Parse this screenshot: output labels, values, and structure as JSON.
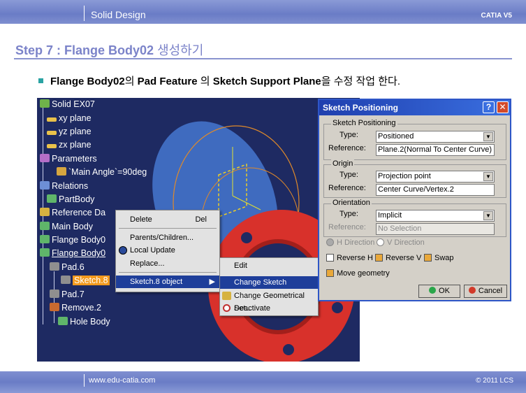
{
  "header": {
    "section_title": "Solid Design",
    "brand": "CATIA V5"
  },
  "slide": {
    "title_en": "Step 7 : Flange Body02",
    "title_ko": "생성하기",
    "bullet": {
      "p1": "Flange Body02",
      "p2": "의 ",
      "p3": "Pad Feature",
      "p4": " 의 ",
      "p5": "Sketch Support Plane",
      "p6": "을 수정 작업 한다."
    }
  },
  "tree": {
    "items": [
      "Solid EX07",
      "xy plane",
      "yz plane",
      "zx plane",
      "Parameters",
      "`Main Angle`=90deg",
      "Relations",
      "PartBody",
      "Reference Da",
      "Main Body",
      "Flange Body0",
      "Flange Body0",
      "Pad.6",
      "Sketch.8",
      "Pad.7",
      "Remove.2",
      "Hole Body"
    ]
  },
  "context_menu": {
    "delete": "Delete",
    "delete_shortcut": "Del",
    "parents_children": "Parents/Children...",
    "local_update": "Local Update",
    "replace": "Replace...",
    "sketch_object": "Sketch.8 object"
  },
  "submenu": {
    "edit": "Edit",
    "change_sketch_support": "Change Sketch Support...",
    "change_geometrical_set": "Change Geometrical Set...",
    "deactivate": "Deactivate"
  },
  "dialog": {
    "title": "Sketch Positioning",
    "help": "?",
    "close": "✕",
    "group_positioning": "Sketch Positioning",
    "type_label": "Type:",
    "reference_label": "Reference:",
    "positioning_type": "Positioned",
    "positioning_reference": "Plane.2(Normal To Center Curve)",
    "group_origin": "Origin",
    "origin_type": "Projection point",
    "origin_reference": "Center Curve/Vertex.2",
    "group_orientation": "Orientation",
    "orientation_type": "Implicit",
    "orientation_reference": "No Selection",
    "h_direction": "H Direction",
    "v_direction": "V Direction",
    "reverse_h": "Reverse H",
    "reverse_v": "Reverse V",
    "swap": "Swap",
    "move_geometry": "Move geometry",
    "ok": "OK",
    "cancel": "Cancel"
  },
  "footer": {
    "url": "www.edu-catia.com",
    "copyright": "© 2011 LCS"
  },
  "colors": {
    "title": "#7b83c9",
    "bar": "#7f8fd0",
    "viewport": "#1e2a62",
    "part_red": "#d8312b",
    "highlight": "#f39a1e"
  }
}
